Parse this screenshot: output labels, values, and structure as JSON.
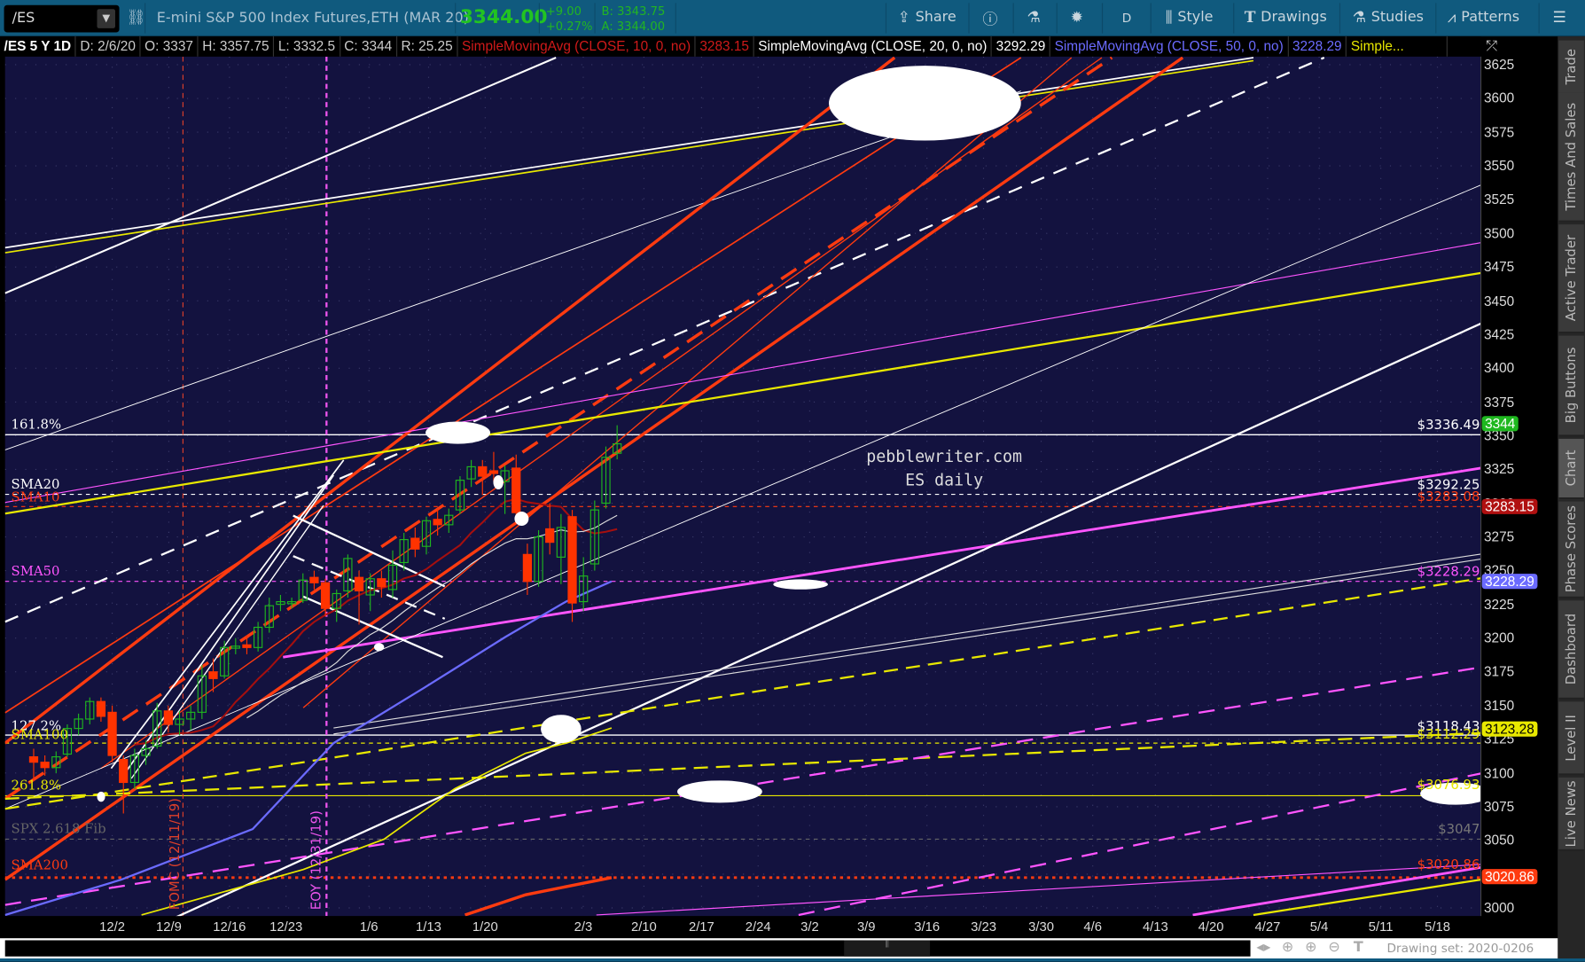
{
  "toolbar": {
    "symbol": "/ES",
    "description": "E-mini S&P 500 Index Futures,ETH (MAR 20)",
    "last": "3344.00",
    "change": "+9.00",
    "change_pct": "+0.27%",
    "bid": "B: 3343.75",
    "ask": "A: 3344.00",
    "share": "Share",
    "period": "D",
    "style": "Style",
    "drawings": "Drawings",
    "studies": "Studies",
    "patterns": "Patterns"
  },
  "infobar": {
    "symbol": "/ES 5 Y 1D",
    "date": "D: 2/6/20",
    "open": "O: 3337",
    "high": "H: 3357.75",
    "low": "L: 3332.5",
    "close": "C: 3344",
    "range": "R: 25.25",
    "sma10": "SimpleMovingAvg (CLOSE, 10, 0, no)",
    "sma10_val": "3283.15",
    "sma20": "SimpleMovingAvg (CLOSE, 20, 0, no)",
    "sma20_val": "3292.29",
    "sma50": "SimpleMovingAvg (CLOSE, 50, 0, no)",
    "sma50_val": "3228.29",
    "more": "Simple..."
  },
  "chart_labels": {
    "fib1618": "161.8%",
    "sma20": "SMA20",
    "sma10": "SMA10",
    "sma50": "SMA50",
    "fib1272": "127.2%",
    "sma100": "SMA100",
    "fib2618": "261.8%",
    "spx_fib": "SPX 2.618 Fib",
    "sma200": "SMA200",
    "fomc": "FOMC (12/11/19)",
    "eoy": "EOY (12/31/19)",
    "watermark1": "pebblewriter.com",
    "watermark2": "ES daily"
  },
  "right_labels": {
    "l1": "$3336.49",
    "l2": "$3292.25",
    "l3": "$3283.08",
    "l4": "$3228.29",
    "l5": "$3118.43",
    "l6": "$3112.29",
    "l7": "$3076.93",
    "l8": "$3047",
    "l9": "$3020.86"
  },
  "price_tags": {
    "last": "3344",
    "sma10": "3283.15",
    "sma50": "3228.29",
    "sma100": "3123.28",
    "sma200": "3020.86"
  },
  "colors": {
    "bg": "#13123f",
    "up": "#1fb51f",
    "down": "#ff3300",
    "sma10": "#a50f0f",
    "sma50": "#6b6bff",
    "sma100": "#e8e800",
    "sma200": "#ff3b10"
  },
  "side_tabs": [
    "Trade",
    "Times And Sales",
    "Active Trader",
    "Big Buttons",
    "Chart",
    "Phase Scores",
    "Dashboard",
    "Level II",
    "Live News"
  ],
  "footer": {
    "drawing_set": "Drawing set: 2020-0206"
  },
  "chart_data": {
    "type": "candlestick",
    "title": "/ES 5 Y 1D",
    "ylim": [
      3000,
      3625
    ],
    "y_ticks": [
      "3625",
      "3600",
      "3575",
      "3550",
      "3525",
      "3500",
      "3475",
      "3450",
      "3425",
      "3400",
      "3375",
      "3350",
      "3325",
      "3300",
      "3275",
      "3250",
      "3225",
      "3200",
      "3175",
      "3150",
      "3125",
      "3100",
      "3075",
      "3050",
      "3025",
      "3000"
    ],
    "x_ticks": [
      "12/2",
      "12/9",
      "12/16",
      "12/23",
      "1/6",
      "1/13",
      "1/20",
      "2/3",
      "2/10",
      "2/17",
      "2/24",
      "3/2",
      "3/9",
      "3/16",
      "3/23",
      "3/30",
      "4/6",
      "4/13",
      "4/20",
      "4/27",
      "5/4",
      "5/11",
      "5/18"
    ],
    "candles": [
      [
        "11/20",
        3112,
        3118,
        3095,
        3108
      ],
      [
        "11/21",
        3108,
        3113,
        3098,
        3104
      ],
      [
        "11/22",
        3104,
        3116,
        3100,
        3112
      ],
      [
        "11/25",
        3114,
        3136,
        3112,
        3133
      ],
      [
        "11/26",
        3133,
        3144,
        3128,
        3140
      ],
      [
        "11/27",
        3140,
        3156,
        3136,
        3153
      ],
      [
        "11/29",
        3153,
        3156,
        3138,
        3142
      ],
      [
        "12/2",
        3145,
        3150,
        3108,
        3113
      ],
      [
        "12/3",
        3110,
        3113,
        3070,
        3093
      ],
      [
        "12/4",
        3093,
        3118,
        3088,
        3113
      ],
      [
        "12/5",
        3113,
        3124,
        3106,
        3118
      ],
      [
        "12/6",
        3120,
        3152,
        3118,
        3146
      ],
      [
        "12/9",
        3146,
        3150,
        3130,
        3136
      ],
      [
        "12/10",
        3136,
        3146,
        3128,
        3140
      ],
      [
        "12/11",
        3140,
        3150,
        3132,
        3145
      ],
      [
        "12/12",
        3145,
        3180,
        3140,
        3172
      ],
      [
        "12/13",
        3175,
        3185,
        3160,
        3170
      ],
      [
        "12/16",
        3172,
        3198,
        3170,
        3193
      ],
      [
        "12/17",
        3193,
        3200,
        3188,
        3194
      ],
      [
        "12/18",
        3195,
        3202,
        3188,
        3193
      ],
      [
        "12/19",
        3193,
        3212,
        3190,
        3208
      ],
      [
        "12/20",
        3208,
        3230,
        3204,
        3224
      ],
      [
        "12/23",
        3225,
        3232,
        3220,
        3227
      ],
      [
        "12/24",
        3227,
        3230,
        3222,
        3227
      ],
      [
        "12/26",
        3228,
        3248,
        3226,
        3243
      ],
      [
        "12/27",
        3245,
        3250,
        3236,
        3241
      ],
      [
        "12/30",
        3241,
        3244,
        3216,
        3222
      ],
      [
        "12/31",
        3222,
        3236,
        3212,
        3233
      ],
      [
        "1/2",
        3235,
        3262,
        3230,
        3259
      ],
      [
        "1/3",
        3245,
        3250,
        3210,
        3235
      ],
      [
        "1/6",
        3232,
        3248,
        3220,
        3244
      ],
      [
        "1/7",
        3244,
        3250,
        3230,
        3238
      ],
      [
        "1/8",
        3236,
        3265,
        3230,
        3254
      ],
      [
        "1/9",
        3256,
        3278,
        3250,
        3273
      ],
      [
        "1/10",
        3274,
        3282,
        3260,
        3266
      ],
      [
        "1/13",
        3268,
        3290,
        3262,
        3287
      ],
      [
        "1/14",
        3288,
        3296,
        3276,
        3284
      ],
      [
        "1/15",
        3284,
        3296,
        3278,
        3291
      ],
      [
        "1/16",
        3295,
        3320,
        3292,
        3317
      ],
      [
        "1/17",
        3318,
        3332,
        3312,
        3327
      ],
      [
        "1/21",
        3327,
        3332,
        3306,
        3320
      ],
      [
        "1/22",
        3324,
        3338,
        3316,
        3322
      ],
      [
        "1/23",
        3316,
        3328,
        3292,
        3324
      ],
      [
        "1/24",
        3326,
        3336,
        3286,
        3293
      ],
      [
        "1/27",
        3262,
        3270,
        3232,
        3242
      ],
      [
        "1/28",
        3242,
        3280,
        3238,
        3275
      ],
      [
        "1/29",
        3281,
        3300,
        3262,
        3271
      ],
      [
        "1/30",
        3260,
        3292,
        3240,
        3282
      ],
      [
        "1/31",
        3290,
        3295,
        3212,
        3226
      ],
      [
        "2/3",
        3227,
        3260,
        3220,
        3246
      ],
      [
        "2/4",
        3255,
        3302,
        3250,
        3295
      ],
      [
        "2/5",
        3300,
        3342,
        3296,
        3334
      ],
      [
        "2/6",
        3337,
        3357.75,
        3332.5,
        3344
      ]
    ]
  }
}
